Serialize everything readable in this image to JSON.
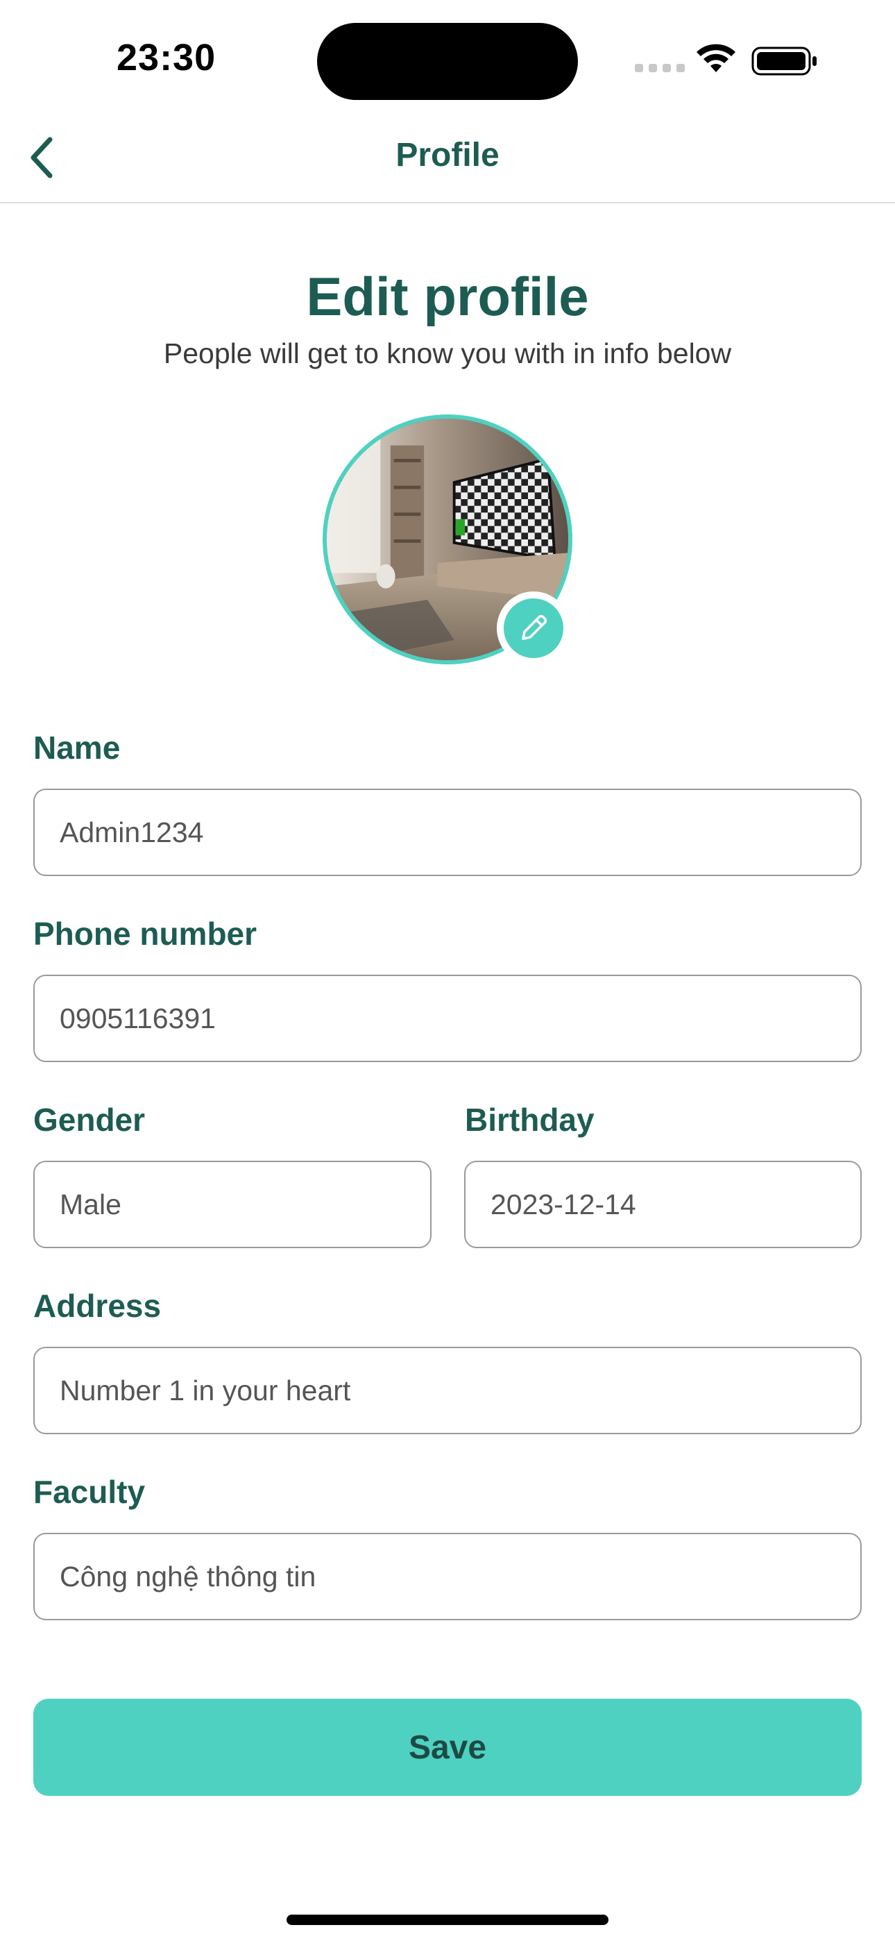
{
  "status_bar": {
    "time": "23:30"
  },
  "nav": {
    "back_icon": "chevron-left-icon",
    "title": "Profile"
  },
  "header": {
    "title": "Edit profile",
    "subtitle": "People will get to know you with in info below"
  },
  "avatar": {
    "edit_icon": "pencil-icon"
  },
  "form": {
    "name": {
      "label": "Name",
      "value": "Admin1234"
    },
    "phone": {
      "label": "Phone number",
      "value": "0905116391"
    },
    "gender": {
      "label": "Gender",
      "value": "Male"
    },
    "birthday": {
      "label": "Birthday",
      "value": "2023-12-14"
    },
    "address": {
      "label": "Address",
      "value": "Number 1 in your heart"
    },
    "faculty": {
      "label": "Faculty",
      "value": "Công nghệ thông tin"
    }
  },
  "save_label": "Save",
  "colors": {
    "accent": "#4fd1c1",
    "heading": "#1d5c52",
    "input_border": "#9a9a9a"
  }
}
